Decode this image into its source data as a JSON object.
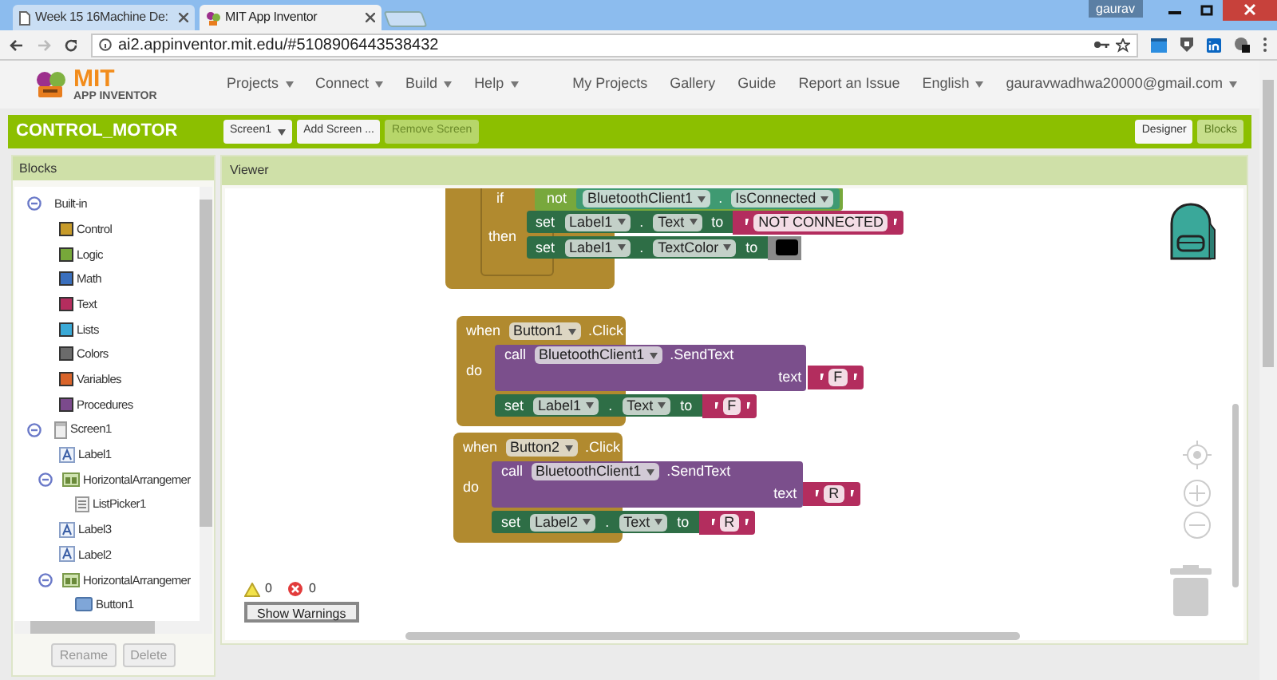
{
  "browser": {
    "tabs": [
      {
        "title": "Week 15 16Machine De:",
        "selected": false
      },
      {
        "title": "MIT App Inventor",
        "selected": true
      }
    ],
    "user": "gaurav",
    "url": "ai2.appinventor.mit.edu/#5108906443538432"
  },
  "header": {
    "logo_top": "MIT",
    "logo_bottom": "APP INVENTOR",
    "menus": [
      "Projects",
      "Connect",
      "Build",
      "Help"
    ],
    "links": [
      "My Projects",
      "Gallery",
      "Guide",
      "Report an Issue"
    ],
    "language": "English",
    "account": "gauravwadhwa20000@gmail.com"
  },
  "project": {
    "name": "CONTROL_MOTOR",
    "screen": "Screen1",
    "buttons": [
      {
        "label": "Add Screen ...",
        "disabled": false
      },
      {
        "label": "Remove Screen",
        "disabled": true
      }
    ],
    "modes": [
      {
        "label": "Designer",
        "selected": false
      },
      {
        "label": "Blocks",
        "selected": true
      }
    ]
  },
  "blocks_panel": {
    "title": "Blocks",
    "tree": [
      {
        "label": "Built-in",
        "kind": "group",
        "expanded": true,
        "children": [
          {
            "label": "Control",
            "kind": "category",
            "color": "#c79b2a"
          },
          {
            "label": "Logic",
            "kind": "category",
            "color": "#77a83a"
          },
          {
            "label": "Math",
            "kind": "category",
            "color": "#3a6fbd"
          },
          {
            "label": "Text",
            "kind": "category",
            "color": "#b52d5e"
          },
          {
            "label": "Lists",
            "kind": "category",
            "color": "#3aa9d6"
          },
          {
            "label": "Colors",
            "kind": "category",
            "color": "#6b6b6b"
          },
          {
            "label": "Variables",
            "kind": "category",
            "color": "#d9642a"
          },
          {
            "label": "Procedures",
            "kind": "category",
            "color": "#7b4a8c"
          }
        ]
      },
      {
        "label": "Screen1",
        "kind": "screen",
        "expanded": true,
        "children": [
          {
            "label": "Label1",
            "kind": "label"
          },
          {
            "label": "HorizontalArrangemer",
            "kind": "arrangement",
            "expanded": true,
            "children": [
              {
                "label": "ListPicker1",
                "kind": "listpicker"
              }
            ]
          },
          {
            "label": "Label3",
            "kind": "label"
          },
          {
            "label": "Label2",
            "kind": "label"
          },
          {
            "label": "HorizontalArrangemer",
            "kind": "arrangement",
            "expanded": true,
            "children": [
              {
                "label": "Button1",
                "kind": "button"
              }
            ]
          }
        ]
      }
    ],
    "buttons": [
      {
        "label": "Rename",
        "disabled": true
      },
      {
        "label": "Delete",
        "disabled": true
      }
    ]
  },
  "viewer": {
    "title": "Viewer",
    "blocks": [
      {
        "kind": "if",
        "keyword": "if",
        "negate": "not",
        "component": "BluetoothClient1",
        "dot": ".",
        "property": "IsConnected",
        "then": "then",
        "statements": [
          {
            "kind": "set",
            "keyword": "set",
            "component": "Label1",
            "dot": ".",
            "property": "Text",
            "to": "to",
            "value": {
              "kind": "text",
              "text": "NOT CONNECTED"
            }
          },
          {
            "kind": "set",
            "keyword": "set",
            "component": "Label1",
            "dot": ".",
            "property": "TextColor",
            "to": "to",
            "value": {
              "kind": "color",
              "color": "#000000"
            }
          }
        ]
      },
      {
        "kind": "event",
        "when": "when",
        "component": "Button1",
        "event": ".Click",
        "do": "do",
        "statements": [
          {
            "kind": "call",
            "keyword": "call",
            "component": "BluetoothClient1",
            "method": ".SendText",
            "arg": "text",
            "value": {
              "kind": "text",
              "text": "F"
            }
          },
          {
            "kind": "set",
            "keyword": "set",
            "component": "Label1",
            "dot": ".",
            "property": "Text",
            "to": "to",
            "value": {
              "kind": "text",
              "text": "F"
            }
          }
        ]
      },
      {
        "kind": "event",
        "when": "when",
        "component": "Button2",
        "event": ".Click",
        "do": "do",
        "statements": [
          {
            "kind": "call",
            "keyword": "call",
            "component": "BluetoothClient1",
            "method": ".SendText",
            "arg": "text",
            "value": {
              "kind": "text",
              "text": "R"
            }
          },
          {
            "kind": "set",
            "keyword": "set",
            "component": "Label2",
            "dot": ".",
            "property": "Text",
            "to": "to",
            "value": {
              "kind": "text",
              "text": "R"
            }
          }
        ]
      }
    ],
    "warnings": "0",
    "errors": "0",
    "show_warnings": "Show Warnings"
  }
}
